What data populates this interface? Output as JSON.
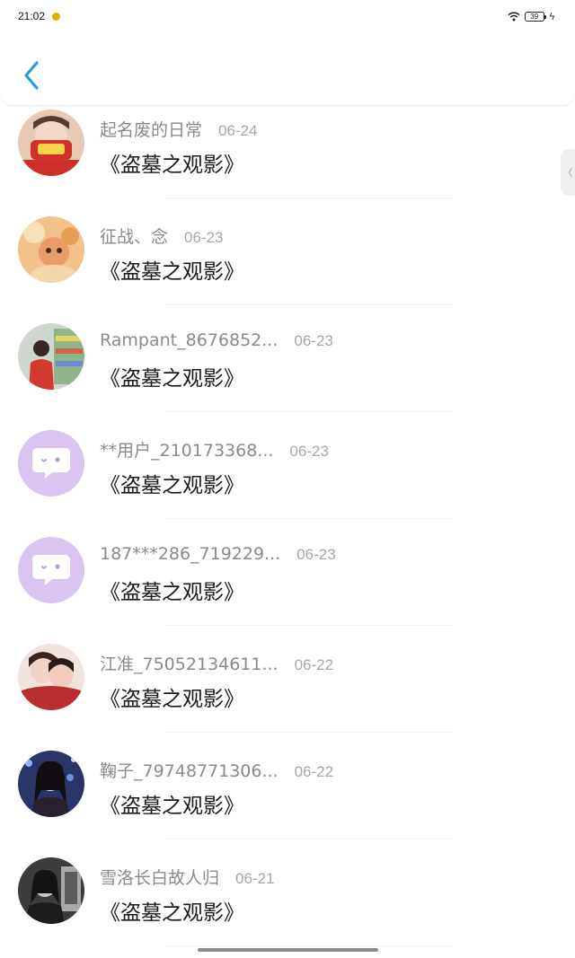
{
  "status_bar": {
    "time": "21:02",
    "battery": "39"
  },
  "comments": [
    {
      "username": "起名废的日常",
      "date": "06-24",
      "text": "《盗墓之观影》",
      "avatar": "photo-red"
    },
    {
      "username": "征战、念",
      "date": "06-23",
      "text": "《盗墓之观影》",
      "avatar": "photo-orange"
    },
    {
      "username": "Rampant_8676852...",
      "date": "06-23",
      "text": "《盗墓之观影》",
      "avatar": "photo-store"
    },
    {
      "username": "**用户_210173368...",
      "date": "06-23",
      "text": "《盗墓之观影》",
      "avatar": "default-chat-icon"
    },
    {
      "username": "187***286_719229...",
      "date": "06-23",
      "text": "《盗墓之观影》",
      "avatar": "default-chat-icon"
    },
    {
      "username": "江准_75052134611...",
      "date": "06-22",
      "text": "《盗墓之观影》",
      "avatar": "photo-couple"
    },
    {
      "username": "鞠子_79748771306...",
      "date": "06-22",
      "text": "《盗墓之观影》",
      "avatar": "photo-girl"
    },
    {
      "username": "雪洛长白故人归",
      "date": "06-21",
      "text": "《盗墓之观影》",
      "avatar": "photo-mono"
    }
  ],
  "colors": {
    "accent": "#2b9be0",
    "username": "#8a8a8a",
    "date": "#a6a6a6",
    "bot_avatar": "#d9c4f2"
  }
}
